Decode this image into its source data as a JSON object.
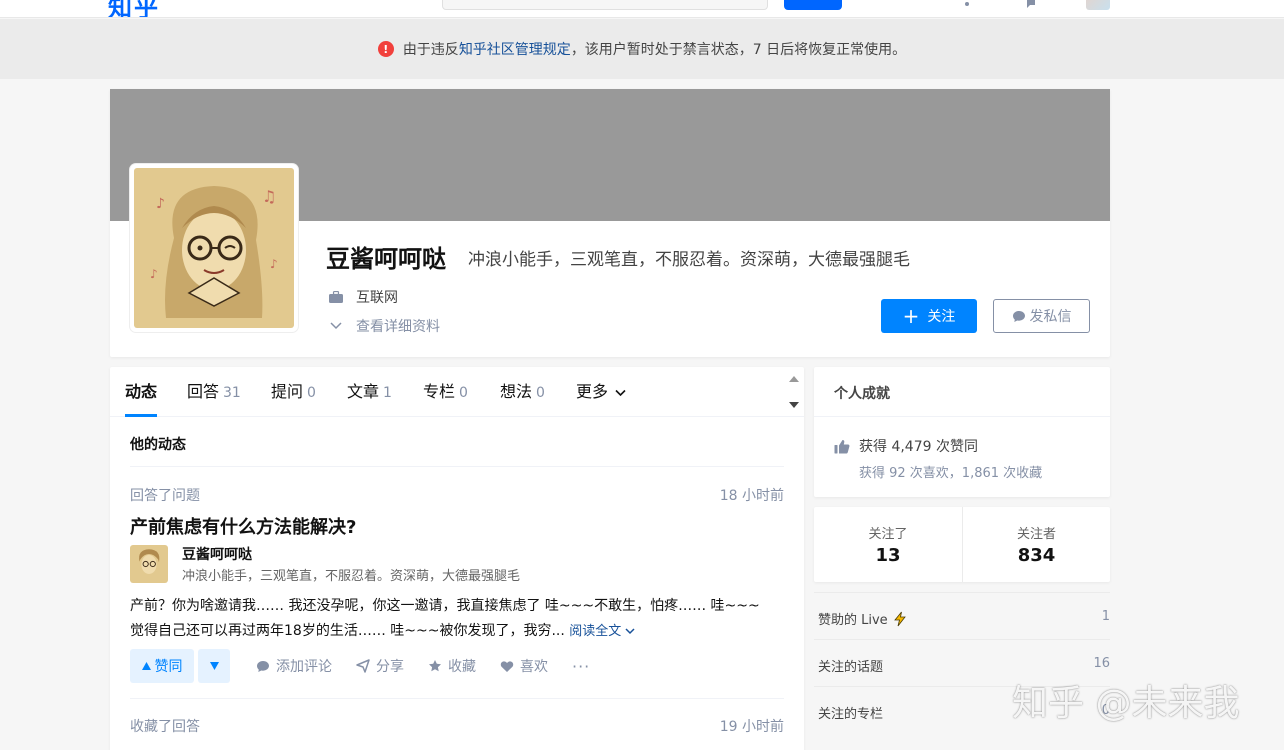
{
  "header": {
    "logo": "知乎"
  },
  "notice": {
    "icon": "!",
    "prefix": "由于违反 ",
    "link": "知乎社区管理规定",
    "suffix": "，该用户暂时处于禁言状态，7 日后将恢复正常使用。",
    "icon_color": "#f1403c"
  },
  "profile": {
    "name": "豆酱呵呵哒",
    "headline": "冲浪小能手，三观笔直，不服忍着。资深萌，大德最强腿毛",
    "industry": "互联网",
    "detail_link": "查看详细资料",
    "follow_label": "关注",
    "message_label": "发私信",
    "cover_color": "#999999",
    "accent": "#0084ff"
  },
  "tabs": [
    {
      "label": "动态",
      "count": ""
    },
    {
      "label": "回答",
      "count": "31"
    },
    {
      "label": "提问",
      "count": "0"
    },
    {
      "label": "文章",
      "count": "1"
    },
    {
      "label": "专栏",
      "count": "0"
    },
    {
      "label": "想法",
      "count": "0"
    },
    {
      "label": "更多",
      "count": ""
    }
  ],
  "feed": {
    "header": "他的动态",
    "items": [
      {
        "meta": "回答了问题",
        "time": "18 小时前",
        "title": "产前焦虑有什么方法能解决?",
        "author_name": "豆酱呵呵哒",
        "author_headline": "冲浪小能手，三观笔直，不服忍着。资深萌，大德最强腿毛",
        "excerpt_line1": "产前？你为啥邀请我…… 我还没孕呢，你这一邀请，我直接焦虑了 哇~~~不敢生，怕疼…… 哇~~~",
        "excerpt_line2": "觉得自己还可以再过两年18岁的生活…… 哇~~~被你发现了，我穷...",
        "read_more": "阅读全文",
        "vote_up": "赞同",
        "comment": "添加评论",
        "share": "分享",
        "collect": "收藏",
        "like": "喜欢",
        "more": "···"
      },
      {
        "meta": "收藏了回答",
        "time": "19 小时前"
      }
    ]
  },
  "achievements": {
    "title": "个人成就",
    "likes": "获得 4,479 次赞同",
    "sub": "获得 92 次喜欢，1,861 次收藏"
  },
  "follow_stats": {
    "following_label": "关注了",
    "following_value": "13",
    "followers_label": "关注者",
    "followers_value": "834"
  },
  "lists": [
    {
      "label": "赞助的 Live",
      "value": "1"
    },
    {
      "label": "关注的话题",
      "value": "16"
    },
    {
      "label": "关注的专栏",
      "value": "0"
    }
  ],
  "watermark": "知乎 @未来我"
}
